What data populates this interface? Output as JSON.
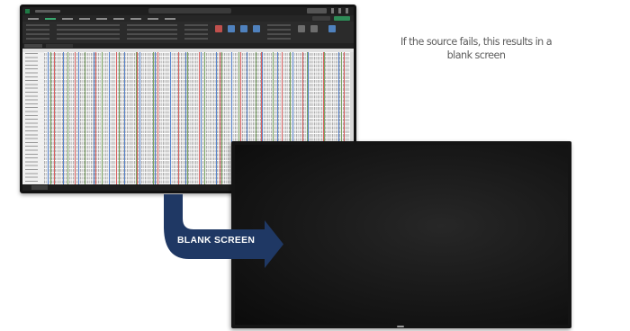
{
  "caption": {
    "line1": "If the source fails, this results in a",
    "line2": "blank screen"
  },
  "arrow": {
    "label": "BLANK SCREEN",
    "color": "#1f3864"
  },
  "source_monitor": {
    "content": "spreadsheet-app"
  },
  "display": {
    "state": "blank",
    "screen_color": "#141414"
  }
}
